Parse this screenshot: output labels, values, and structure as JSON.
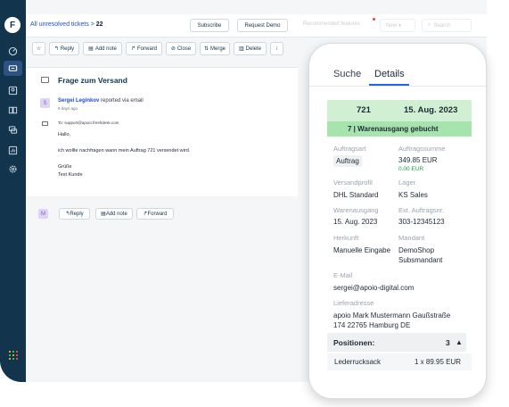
{
  "topbar": {
    "breadcrumb_link": "All unresolved tickets",
    "breadcrumb_sep": ">",
    "ticket_number": "22",
    "subscribe_label": "Subscribe",
    "request_demo_label": "Request Demo",
    "recommended_label": "Recommended features",
    "new_label": "New",
    "search_placeholder": "Search"
  },
  "toolbar": {
    "reply": "Reply",
    "add_note": "Add note",
    "forward": "Forward",
    "close": "Close",
    "merge": "Merge",
    "delete": "Delete",
    "more": "⁝"
  },
  "ticket": {
    "subject": "Frage zum Versand",
    "sender_avatar": "S",
    "sender_name": "Sergei Leginkov",
    "sender_action": "reported via email",
    "time": "9 days ago",
    "to_line": "To: support@apoio.freshdesk.com",
    "greeting": "Hallo,",
    "body": "ich wollte nachfragen wann mein Auftrag 721 versendet wird.",
    "closing": "Grüße",
    "signature": "Test Kunde"
  },
  "replybar": {
    "avatar": "M",
    "reply": "Reply",
    "add_note": "Add note",
    "forward": "Forward"
  },
  "panel": {
    "tabs": [
      {
        "label": "Suche"
      },
      {
        "label": "Details"
      }
    ],
    "order_id": "721",
    "order_date": "15. Aug. 2023",
    "status": "7 | Warenausgang gebucht",
    "fields": {
      "auftragsart_label": "Auftragsart",
      "auftragsart_value": "Auftrag",
      "summe_label": "Auftragssumme",
      "summe_value": "349.85 EUR",
      "summe_sub": "0.00 EUR",
      "versandprofil_label": "Versandprofil",
      "versandprofil_value": "DHL Standard",
      "lager_label": "Lager",
      "lager_value": "KS Sales",
      "warenausgang_label": "Warenausgang",
      "warenausgang_value": "15. Aug. 2023",
      "ext_label": "Ext. Auftragsnr.",
      "ext_value": "303-12345123",
      "herkunft_label": "Herkunft",
      "herkunft_value": "Manuelle Eingabe",
      "mandant_label": "Mandant",
      "mandant_value_1": "DemoShop",
      "mandant_value_2": "Subsmandant",
      "email_label": "E-Mail",
      "email_value": "sergei@apoio-digital.com",
      "adresse_label": "Lieferadresse",
      "adresse_line1": "apoio Mark Mustermann Gaußstraße",
      "adresse_line2": "174 22765 Hamburg DE"
    },
    "positionen_label": "Positionen:",
    "positionen_count": "3",
    "item_name": "Lederrucksack",
    "item_qty": "1 x 89.95 EUR"
  }
}
